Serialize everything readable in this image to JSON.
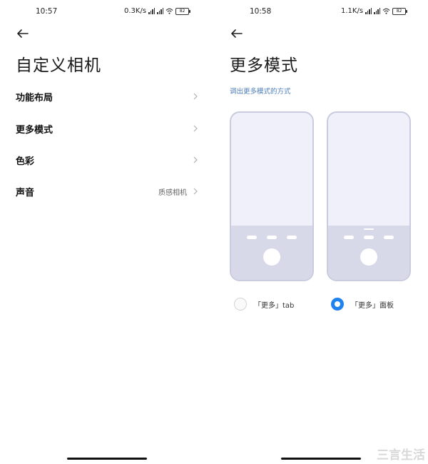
{
  "left_screen": {
    "status_bar": {
      "time": "10:57",
      "network_speed": "0.3K/s",
      "battery": "82"
    },
    "title": "自定义相机",
    "menu_items": [
      {
        "label": "功能布局",
        "value": ""
      },
      {
        "label": "更多模式",
        "value": ""
      },
      {
        "label": "色彩",
        "value": ""
      },
      {
        "label": "声音",
        "value": "质感相机"
      }
    ]
  },
  "right_screen": {
    "status_bar": {
      "time": "10:58",
      "network_speed": "1.1K/s",
      "battery": "82"
    },
    "title": "更多模式",
    "subtitle": "调出更多模式的方式",
    "options": [
      {
        "label": "「更多」tab",
        "selected": false
      },
      {
        "label": "「更多」面板",
        "selected": true
      }
    ]
  },
  "icons": {
    "back": "arrow-left-icon",
    "chevron": "chevron-right-icon",
    "signal": "signal-icon",
    "wifi": "wifi-icon",
    "battery": "battery-icon"
  },
  "colors": {
    "accent": "#1e82f0",
    "subtitle": "#4a7bb8",
    "phone_border": "#c9ccdf",
    "phone_bottom": "#d7d9e8"
  },
  "watermark": "三言生活"
}
